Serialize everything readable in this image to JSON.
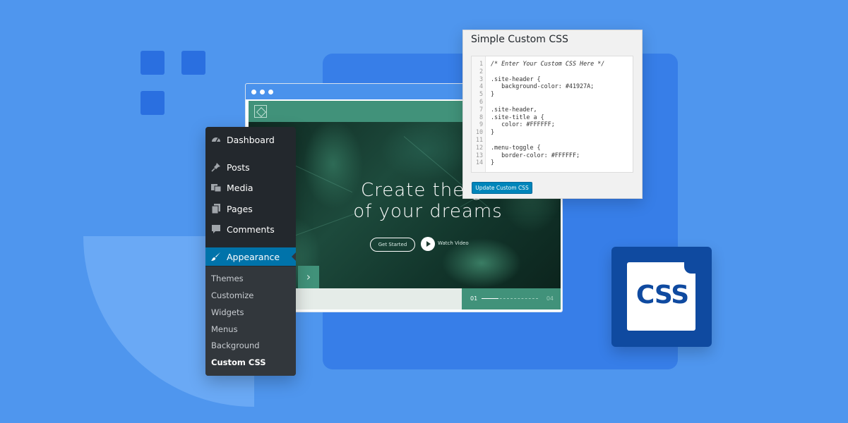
{
  "colors": {
    "background": "#4f96ee",
    "panel": "#377ee8",
    "site_header": "#41927A",
    "wp_sidebar": "#23282d",
    "wp_active": "#0073aa",
    "css_badge": "#0f4aa0"
  },
  "preview": {
    "hero_title_line1": "Create the ga",
    "hero_title_line2": "of your dreams",
    "get_started": "Get Started",
    "watch_video": "Watch Video",
    "slide_current": "01",
    "slide_total": "04",
    "arrow": "›"
  },
  "sidebar": {
    "items": [
      {
        "label": "Dashboard",
        "icon": "dashboard-icon"
      },
      {
        "label": "Posts",
        "icon": "pin-icon"
      },
      {
        "label": "Media",
        "icon": "media-icon"
      },
      {
        "label": "Pages",
        "icon": "pages-icon"
      },
      {
        "label": "Comments",
        "icon": "comment-icon"
      },
      {
        "label": "Appearance",
        "icon": "brush-icon"
      }
    ],
    "submenu": [
      "Themes",
      "Customize",
      "Widgets",
      "Menus",
      "Background",
      "Custom CSS"
    ]
  },
  "css_window": {
    "title": "Simple Custom CSS",
    "lines": [
      "/* Enter Your Custom CSS Here */",
      "",
      ".site-header {",
      "   background-color: #41927A;",
      "}",
      "",
      ".site-header,",
      ".site-title a {",
      "   color: #FFFFFF;",
      "}",
      "",
      ".menu-toggle {",
      "   border-color: #FFFFFF;",
      "}"
    ],
    "line_numbers": [
      "1",
      "2",
      "3",
      "4",
      "5",
      "6",
      "7",
      "8",
      "9",
      "10",
      "11",
      "12",
      "13",
      "14"
    ],
    "button": "Update Custom CSS"
  },
  "badge": {
    "label": "CSS",
    "icon": "css-file-icon"
  }
}
